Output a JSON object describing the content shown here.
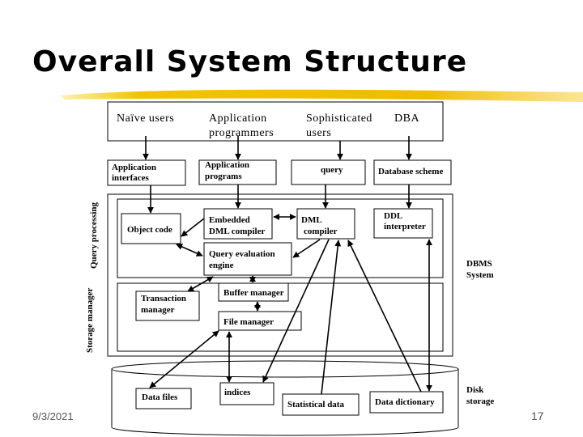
{
  "slide": {
    "title": "Overall System Structure",
    "date": "9/3/2021",
    "page_number": "17",
    "accent_color": "#f2c200"
  },
  "diagram": {
    "users": {
      "naive": "Naïve users",
      "app_prog_1": "Application",
      "app_prog_2": "programmers",
      "soph_1": "Sophisticated",
      "soph_2": "users",
      "dba": "DBA"
    },
    "interfaces": {
      "app_interfaces_1": "Application",
      "app_interfaces_2": "interfaces",
      "app_programs_1": "Application",
      "app_programs_2": "programs",
      "query": "query",
      "db_scheme": "Database scheme"
    },
    "query_processing": {
      "label": "Query processing",
      "object_code": "Object code",
      "embedded_1": "Embedded",
      "embedded_2": "DML compiler",
      "dml_1": "DML",
      "dml_2": "compiler",
      "ddl_1": "DDL",
      "ddl_2": "interpreter",
      "qe_1": "Query evaluation",
      "qe_2": "engine"
    },
    "dbms_1": "DBMS",
    "dbms_2": "System",
    "storage_manager": {
      "label": "Storage manager",
      "tm_1": "Transaction",
      "tm_2": "manager",
      "buffer": "Buffer manager",
      "file": "File manager"
    },
    "disk": {
      "label_1": "Disk",
      "label_2": "storage",
      "data_files": "Data files",
      "indices": "indices",
      "statistical": "Statistical data",
      "dictionary": "Data dictionary"
    }
  }
}
